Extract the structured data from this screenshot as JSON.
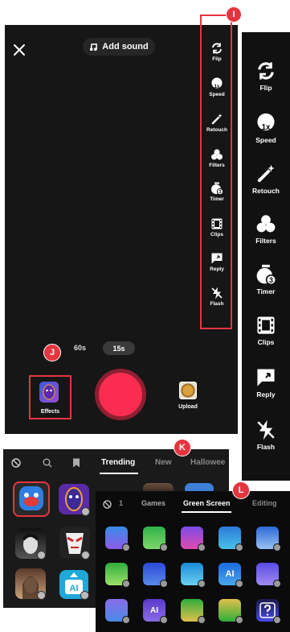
{
  "camera": {
    "add_sound": "Add sound",
    "durations": [
      "60s",
      "15s"
    ],
    "effects_label": "Effects",
    "upload_label": "Upload"
  },
  "side_tools": [
    "Flip",
    "Speed",
    "Retouch",
    "Filters",
    "Timer",
    "Clips",
    "Reply",
    "Flash"
  ],
  "callouts": [
    "I",
    "J",
    "K",
    "L"
  ],
  "panel_k": {
    "tabs": [
      "Trending",
      "New",
      "Hallowee"
    ]
  },
  "panel_l": {
    "tabs": [
      "1",
      "Games",
      "Green Screen",
      "Editing"
    ],
    "ai_label": "AI"
  },
  "colors": {
    "accent": "#fa2d51",
    "callout": "#e5353f",
    "background": "#161616"
  }
}
